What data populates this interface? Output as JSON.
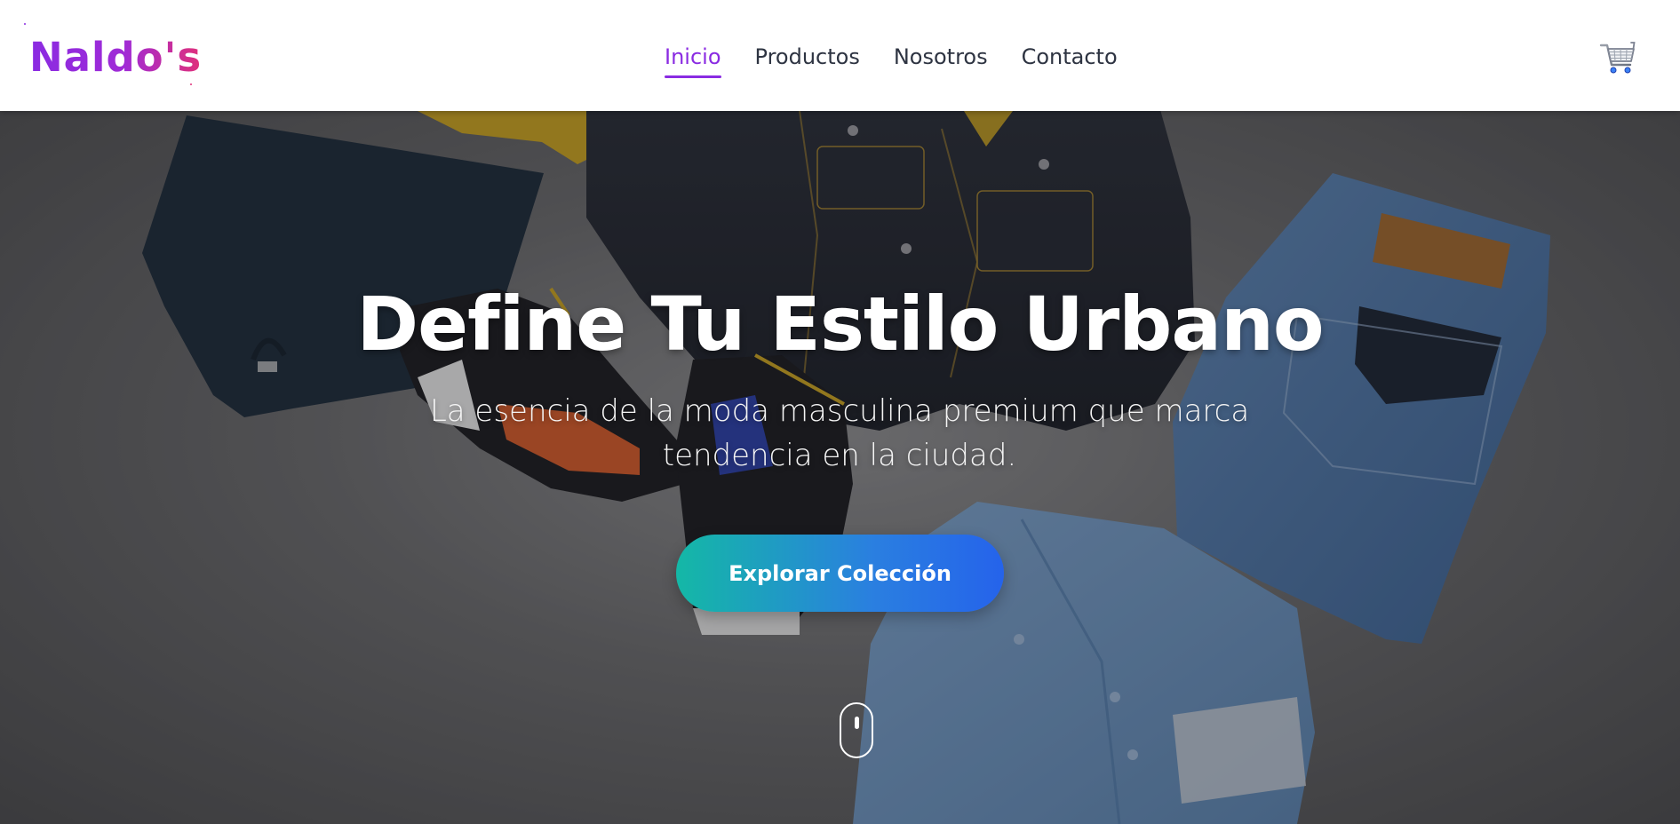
{
  "header": {
    "logo_text": "Naldo's",
    "nav": [
      {
        "label": "Inicio",
        "active": true
      },
      {
        "label": "Productos",
        "active": false
      },
      {
        "label": "Nosotros",
        "active": false
      },
      {
        "label": "Contacto",
        "active": false
      }
    ],
    "cart_icon": "shopping-cart-icon"
  },
  "hero": {
    "title": "Define Tu Estilo Urbano",
    "subtitle": "La esencia de la moda masculina premium que marca tendencia en la ciudad.",
    "cta_label": "Explorar Colección",
    "scroll_icon": "mouse-scroll-icon"
  },
  "colors": {
    "brand_purple": "#8a2be2",
    "brand_pink": "#e0307a",
    "nav_text": "#2e3442",
    "cta_start": "#14b8a6",
    "cta_end": "#2563eb"
  }
}
